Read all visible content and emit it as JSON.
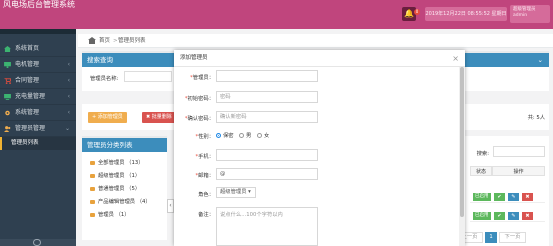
{
  "header": {
    "title": "风电场后台管理系统",
    "notification_count": "0",
    "clock": "2019年12月22日 08:55:52 星期日",
    "user_line1": "超级管理员",
    "user_line2": "admin"
  },
  "sidebar": {
    "items": [
      {
        "label": "系统首页",
        "color": "#3cb371"
      },
      {
        "label": "电机管理",
        "color": "#3cb371",
        "caret": "‹"
      },
      {
        "label": "合同管理",
        "color": "#e74c3c",
        "caret": "‹"
      },
      {
        "label": "充电量管理",
        "color": "#3cb371",
        "caret": "‹"
      },
      {
        "label": "系统管理",
        "color": "#f0ad4e",
        "caret": "‹"
      },
      {
        "label": "管理员管理",
        "color": "#f0ad4e",
        "caret": "⌄"
      }
    ],
    "sub_item": "管理员列表"
  },
  "breadcrumb": {
    "home": "首页",
    "separator": ">",
    "current": "管理员列表"
  },
  "search_panel": {
    "title": "搜索查询",
    "name_label": "管理员名称:",
    "chevron": "⌄"
  },
  "toolbar": {
    "add_label": "+ 添加管理员",
    "delete_label": "✖ 批量删除",
    "total_text": "共: 5人"
  },
  "tree_panel": {
    "title": "管理员分类列表",
    "items": [
      "全部管理员 （13）",
      "超级管理员 （1）",
      "普通管理员 （5）",
      "产品编辑管理员 （4）",
      "管理员 （1）"
    ]
  },
  "table": {
    "search_label": "搜索:",
    "col_status": "状态",
    "col_ops": "操作",
    "status_tag": "已启用"
  },
  "pagination": {
    "prev": "上一页",
    "page": "1",
    "next": "下一页"
  },
  "modal": {
    "title": "添加管理员",
    "close": "×",
    "labels": {
      "username": "管理员：",
      "password": "初始密码：",
      "confirm": "确认密码：",
      "gender": "性别：",
      "phone": "手机：",
      "email": "邮箱：",
      "role": "角色：",
      "note": "备注："
    },
    "password_placeholder": "密码",
    "confirm_placeholder": "确认新密码",
    "gender_options": [
      "保密",
      "男",
      "女"
    ],
    "email_value": "@",
    "role_value": "超级管理员 ▾",
    "note_placeholder": "说点什么...100个字符以内"
  }
}
